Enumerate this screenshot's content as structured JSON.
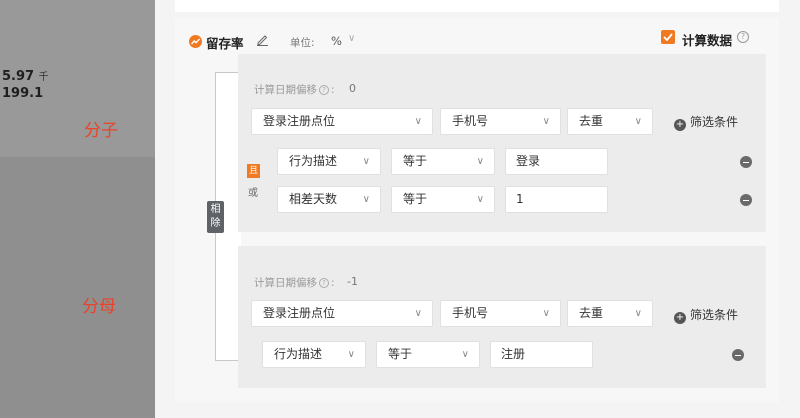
{
  "left_panel": {
    "value1": "5.97",
    "value1_unit": "千",
    "value2": "199.1"
  },
  "annotations": {
    "numerator": "分子",
    "denominator": "分母"
  },
  "metric": {
    "name": "留存率",
    "unit_label": "单位:",
    "unit_value": "%",
    "calc_label": "计算数据",
    "calc_checked": true,
    "operator_label": "相除"
  },
  "numerator": {
    "offset_label": "计算日期偏移",
    "offset_colon": ":",
    "offset_value": "0",
    "event": "登录注册点位",
    "id_field": "手机号",
    "agg": "去重",
    "add_filter": "筛选条件",
    "logic_and": "且",
    "logic_or": "或",
    "filters": [
      {
        "field": "行为描述",
        "op": "等于",
        "value": "登录"
      },
      {
        "field": "相差天数",
        "op": "等于",
        "value": "1"
      }
    ]
  },
  "denominator": {
    "offset_label": "计算日期偏移",
    "offset_colon": ":",
    "offset_value": "-1",
    "event": "登录注册点位",
    "id_field": "手机号",
    "agg": "去重",
    "add_filter": "筛选条件",
    "filters": [
      {
        "field": "行为描述",
        "op": "等于",
        "value": "注册"
      }
    ]
  },
  "colors": {
    "accent": "#f07a22",
    "annotation": "#e8442a"
  },
  "icons": {
    "metric": "trend-up-icon",
    "edit": "pencil-icon",
    "help": "question-circle-icon",
    "add": "plus-circle-icon",
    "remove": "minus-circle-icon",
    "dropdown": "chevron-down-icon"
  }
}
